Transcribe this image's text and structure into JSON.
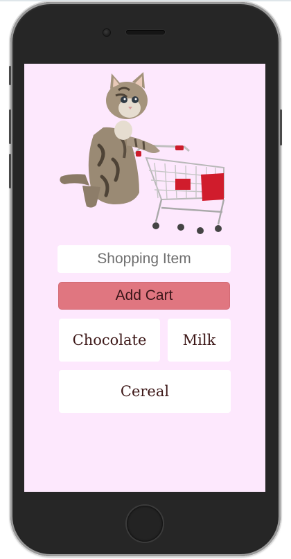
{
  "form": {
    "input_placeholder": "Shopping Item",
    "add_button_label": "Add Cart"
  },
  "cart": {
    "items": [
      "Chocolate",
      "Milk",
      "Cereal"
    ]
  },
  "theme": {
    "screen_background": "#fde8fd",
    "button_color": "#e07680",
    "card_color": "#ffffff",
    "text_color": "#3d1818"
  },
  "illustration": {
    "subject": "kitten-pushing-shopping-cart"
  }
}
